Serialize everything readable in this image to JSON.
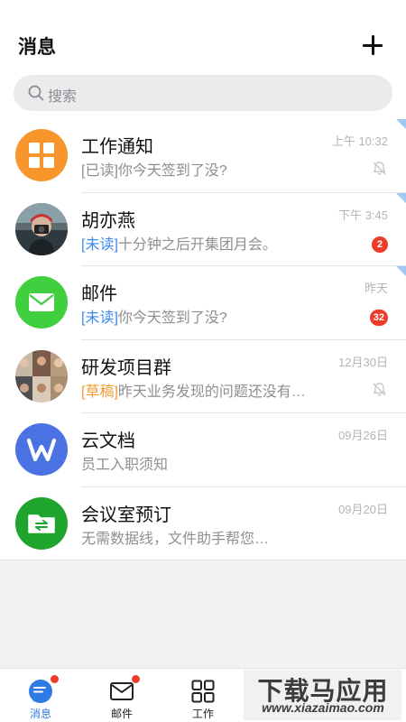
{
  "header": {
    "title": "消息",
    "add_icon": "plus-icon"
  },
  "search": {
    "placeholder": "搜索",
    "icon": "search-icon"
  },
  "conversations": [
    {
      "name": "工作通知",
      "time": "上午 10:32",
      "tag": "[已读]",
      "tag_type": "read",
      "preview": "你今天签到了没?",
      "badge": "",
      "muted": true,
      "pinned": true,
      "avatar_icon": "grid-app-icon",
      "avatar_color": "#f7962d"
    },
    {
      "name": "胡亦燕",
      "time": "下午 3:45",
      "tag": "[未读]",
      "tag_type": "unread",
      "preview": "十分钟之后开集团月会。",
      "badge": "2",
      "muted": false,
      "pinned": true,
      "avatar_icon": "user-photo-avatar",
      "avatar_color": "#3d4a52"
    },
    {
      "name": "邮件",
      "time": "昨天",
      "tag": "[未读]",
      "tag_type": "unread",
      "preview": "你今天签到了没?",
      "badge": "32",
      "muted": false,
      "pinned": true,
      "avatar_icon": "mail-icon",
      "avatar_color": "#3fcf3f"
    },
    {
      "name": "研发项目群",
      "time": "12月30日",
      "tag": "[草稿]",
      "tag_type": "draft",
      "preview": "昨天业务发现的问题还没有…",
      "badge": "",
      "muted": true,
      "pinned": false,
      "avatar_icon": "group-photo-avatar",
      "avatar_color": "#8a7566"
    },
    {
      "name": "云文档",
      "time": "09月26日",
      "tag": "",
      "tag_type": "",
      "preview": "员工入职须知",
      "badge": "",
      "muted": false,
      "pinned": false,
      "avatar_icon": "wps-icon",
      "avatar_color": "#4a72e3"
    },
    {
      "name": "会议室预订",
      "time": "09月20日",
      "tag": "",
      "tag_type": "",
      "preview": "无需数据线，文件助手帮您…",
      "badge": "",
      "muted": false,
      "pinned": false,
      "avatar_icon": "file-transfer-icon",
      "avatar_color": "#1fa42e"
    }
  ],
  "tabbar": {
    "active_color": "#2f7be6",
    "tabs": [
      {
        "label": "消息",
        "icon": "chat-bubble-icon",
        "active": true,
        "dot": true
      },
      {
        "label": "邮件",
        "icon": "mail-icon",
        "active": false,
        "dot": true
      },
      {
        "label": "工作",
        "icon": "grid-icon",
        "active": false,
        "dot": false
      }
    ]
  },
  "watermark": {
    "title": "下载马应用",
    "url": "www.xiazaimao.com"
  }
}
